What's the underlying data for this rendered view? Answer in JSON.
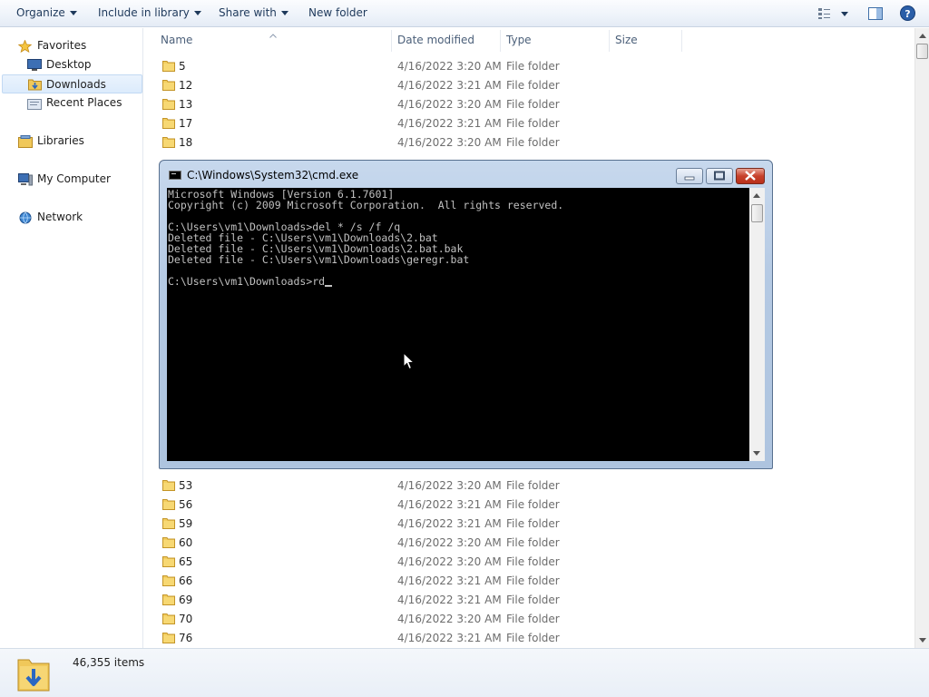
{
  "toolbar": {
    "organize": "Organize",
    "include_in_library": "Include in library",
    "share_with": "Share with",
    "new_folder": "New folder",
    "icons": [
      "view-options-icon",
      "preview-pane-icon",
      "help-icon"
    ]
  },
  "nav": {
    "favorites": "Favorites",
    "desktop": "Desktop",
    "downloads": "Downloads",
    "recent_places": "Recent Places",
    "libraries": "Libraries",
    "my_computer": "My Computer",
    "network": "Network"
  },
  "columns": {
    "name": "Name",
    "date_modified": "Date modified",
    "type": "Type",
    "size": "Size"
  },
  "rows_top": [
    {
      "name": "5",
      "date": "4/16/2022 3:20 AM",
      "type": "File folder"
    },
    {
      "name": "12",
      "date": "4/16/2022 3:21 AM",
      "type": "File folder"
    },
    {
      "name": "13",
      "date": "4/16/2022 3:20 AM",
      "type": "File folder"
    },
    {
      "name": "17",
      "date": "4/16/2022 3:21 AM",
      "type": "File folder"
    },
    {
      "name": "18",
      "date": "4/16/2022 3:20 AM",
      "type": "File folder"
    }
  ],
  "rows_bottom": [
    {
      "name": "53",
      "date": "4/16/2022 3:20 AM",
      "type": "File folder"
    },
    {
      "name": "56",
      "date": "4/16/2022 3:21 AM",
      "type": "File folder"
    },
    {
      "name": "59",
      "date": "4/16/2022 3:21 AM",
      "type": "File folder"
    },
    {
      "name": "60",
      "date": "4/16/2022 3:20 AM",
      "type": "File folder"
    },
    {
      "name": "65",
      "date": "4/16/2022 3:20 AM",
      "type": "File folder"
    },
    {
      "name": "66",
      "date": "4/16/2022 3:21 AM",
      "type": "File folder"
    },
    {
      "name": "69",
      "date": "4/16/2022 3:21 AM",
      "type": "File folder"
    },
    {
      "name": "70",
      "date": "4/16/2022 3:20 AM",
      "type": "File folder"
    },
    {
      "name": "76",
      "date": "4/16/2022 3:21 AM",
      "type": "File folder"
    }
  ],
  "status": {
    "item_count": "46,355 items"
  },
  "cmd": {
    "title": "C:\\Windows\\System32\\cmd.exe",
    "lines": [
      "Microsoft Windows [Version 6.1.7601]",
      "Copyright (c) 2009 Microsoft Corporation.  All rights reserved.",
      "",
      "C:\\Users\\vm1\\Downloads>del * /s /f /q",
      "Deleted file - C:\\Users\\vm1\\Downloads\\2.bat",
      "Deleted file - C:\\Users\\vm1\\Downloads\\2.bat.bak",
      "Deleted file - C:\\Users\\vm1\\Downloads\\geregr.bat",
      "",
      "C:\\Users\\vm1\\Downloads>rd"
    ]
  },
  "colors": {
    "console_bg": "#000000",
    "console_text": "#c0c0c0",
    "close_button": "#c7412c",
    "selection": "#dcebfc"
  }
}
